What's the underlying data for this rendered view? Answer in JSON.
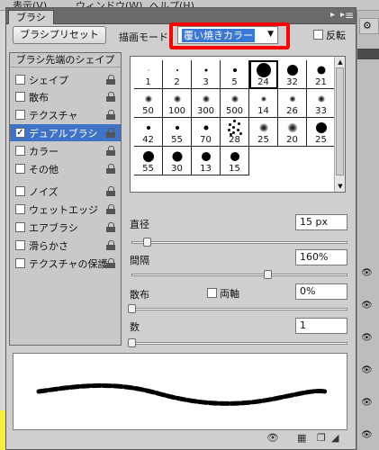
{
  "app_menu": [
    "表示(V)",
    "ウィンドウ(W)",
    "ヘルプ(H)"
  ],
  "panel": {
    "tab_label": "ブラシ",
    "preset_button": "ブラシプリセット",
    "mode_label": "描画モード：",
    "mode_value": "覆い焼きカラー",
    "flip_label": "反転"
  },
  "left_list": {
    "header": "ブラシ先端のシェイプ",
    "items": [
      {
        "label": "シェイプ",
        "checked": false
      },
      {
        "label": "散布",
        "checked": false
      },
      {
        "label": "テクスチャ",
        "checked": false
      },
      {
        "label": "デュアルブラシ",
        "checked": true,
        "selected": true
      },
      {
        "label": "カラー",
        "checked": false
      },
      {
        "label": "その他",
        "checked": false
      },
      {
        "label": "ノイズ",
        "checked": false
      },
      {
        "label": "ウェットエッジ",
        "checked": false
      },
      {
        "label": "エアブラシ",
        "checked": false
      },
      {
        "label": "滑らかさ",
        "checked": false
      },
      {
        "label": "テクスチャの保護",
        "checked": false
      }
    ]
  },
  "brush_tips": [
    {
      "size": "1"
    },
    {
      "size": "2"
    },
    {
      "size": "3"
    },
    {
      "size": "5"
    },
    {
      "size": "24",
      "selected": true
    },
    {
      "size": "32"
    },
    {
      "size": "21"
    },
    {
      "size": "50"
    },
    {
      "size": "100"
    },
    {
      "size": "300"
    },
    {
      "size": "500"
    },
    {
      "size": "14"
    },
    {
      "size": "26"
    },
    {
      "size": "33"
    },
    {
      "size": "42"
    },
    {
      "size": "55"
    },
    {
      "size": "70"
    },
    {
      "size": "28"
    },
    {
      "size": "25"
    },
    {
      "size": "20"
    },
    {
      "size": "25"
    },
    {
      "size": "55"
    },
    {
      "size": "30"
    },
    {
      "size": "13"
    },
    {
      "size": "15"
    }
  ],
  "params": {
    "diameter_label": "直径",
    "diameter_value": "15 px",
    "diameter_level": 0.07,
    "spacing_label": "間隔",
    "spacing_value": "160%",
    "spacing_level": 0.64,
    "scatter_label": "散布",
    "both_axes_label": "両軸",
    "scatter_value": "0%",
    "scatter_level": 0,
    "count_label": "数",
    "count_value": "1",
    "count_level": 0
  }
}
